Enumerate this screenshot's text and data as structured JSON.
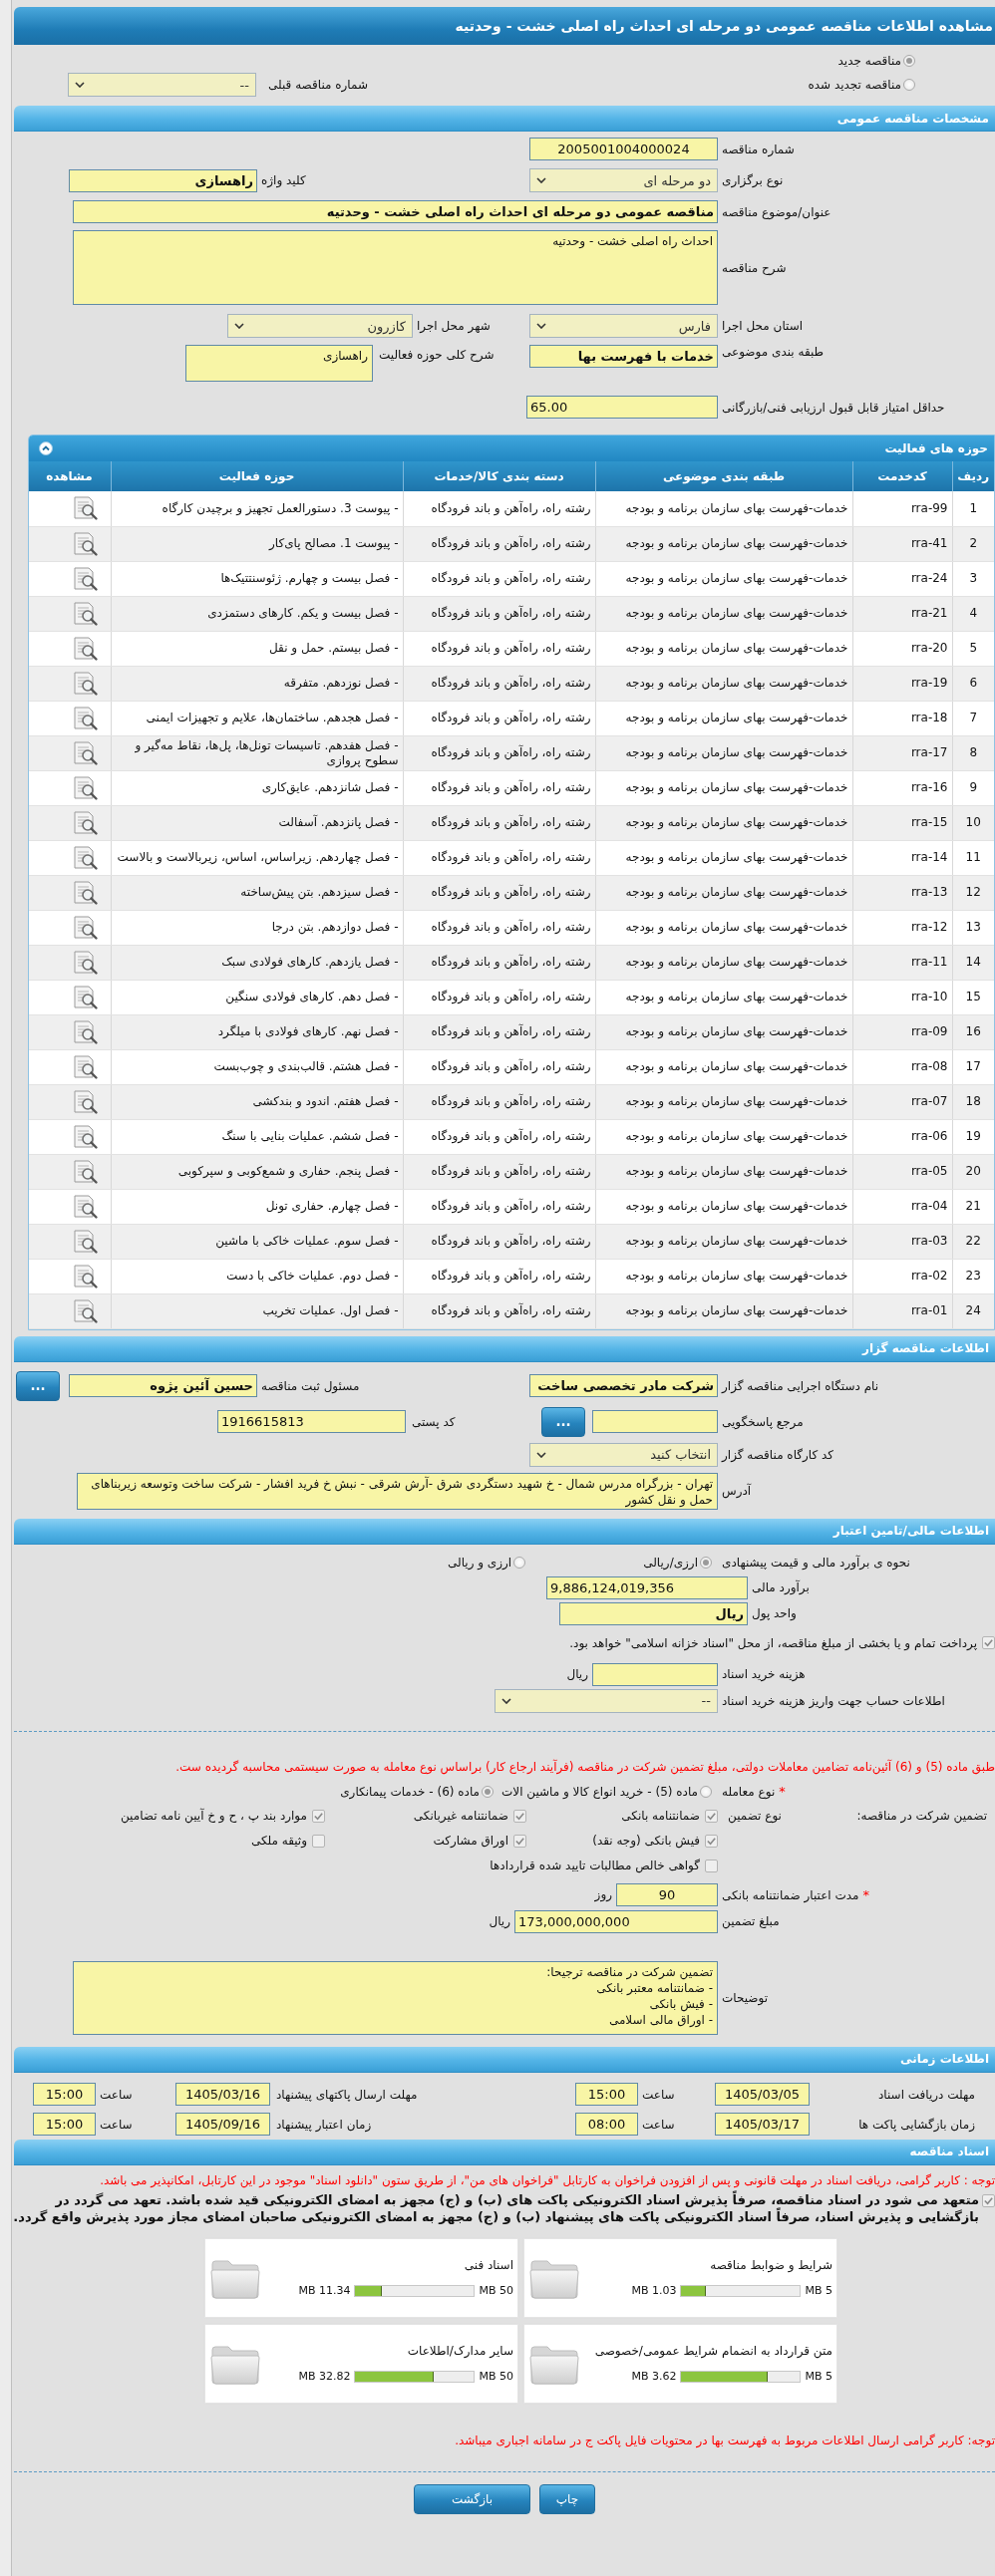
{
  "page_title": "مشاهده اطلاعات مناقصه عمومی دو مرحله ای احداث راه اصلی خشت - وحدتیه",
  "tender_status": [
    {
      "label": "مناقصه جدید",
      "selected": true
    },
    {
      "label": "مناقصه تجدید شده",
      "selected": false
    }
  ],
  "previous_tender": {
    "label": "شماره مناقصه قبلی",
    "value": "--"
  },
  "general": {
    "heading": "مشخصات مناقصه عمومی",
    "number": {
      "label": "شماره مناقصه",
      "value": "2005001004000024"
    },
    "procedure": {
      "label": "نوع برگزاری",
      "value": "دو مرحله ای"
    },
    "keyword": {
      "label": "کلید واژه",
      "value": "راهسازی"
    },
    "subject": {
      "label": "عنوان/موضوع مناقصه",
      "value": "مناقصه عمومی دو مرحله ای احداث راه اصلی خشت - وحدتیه"
    },
    "description": {
      "label": "شرح مناقصه",
      "value": "احداث راه اصلی خشت - وحدتیه"
    },
    "province": {
      "label": "استان محل اجرا",
      "value": "فارس"
    },
    "city": {
      "label": "شهر محل اجرا",
      "value": "کازرون"
    },
    "classification": {
      "label": "طبقه بندی موضوعی",
      "value": "خدمات با فهرست بها"
    },
    "activity_summary": {
      "label": "شرح کلی حوزه فعالیت",
      "value": "راهسازی"
    },
    "min_score": {
      "label": "حداقل امتیاز قابل قبول ارزیابی فنی/بازرگانی",
      "value": "65.00"
    }
  },
  "activities": {
    "heading": "حوزه های فعالیت",
    "columns": [
      "ردیف",
      "کدخدمت",
      "طبقه بندی موضوعی",
      "دسته بندی کالا/خدمات",
      "حوزه فعالیت",
      "مشاهده"
    ],
    "rows": [
      {
        "row": "1",
        "code": "rra-99",
        "classification": "خدمات-فهرست بهای سازمان برنامه و بودجه",
        "group": "رشته راه، راه‌آهن و باند فرودگاه",
        "activity": "- پیوست 3. دستورالعمل تجهیز و برچیدن کارگاه"
      },
      {
        "row": "2",
        "code": "rra-41",
        "classification": "خدمات-فهرست بهای سازمان برنامه و بودجه",
        "group": "رشته راه، راه‌آهن و باند فرودگاه",
        "activity": "- پیوست 1. مصالح پای‌کار"
      },
      {
        "row": "3",
        "code": "rra-24",
        "classification": "خدمات-فهرست بهای سازمان برنامه و بودجه",
        "group": "رشته راه، راه‌آهن و باند فرودگاه",
        "activity": "- فصل بیست و چهارم. ژئوسنتتیک‌ها"
      },
      {
        "row": "4",
        "code": "rra-21",
        "classification": "خدمات-فهرست بهای سازمان برنامه و بودجه",
        "group": "رشته راه، راه‌آهن و باند فرودگاه",
        "activity": "- فصل بیست و یکم. کارهای دستمزدی"
      },
      {
        "row": "5",
        "code": "rra-20",
        "classification": "خدمات-فهرست بهای سازمان برنامه و بودجه",
        "group": "رشته راه، راه‌آهن و باند فرودگاه",
        "activity": "- فصل بیستم. حمل و نقل"
      },
      {
        "row": "6",
        "code": "rra-19",
        "classification": "خدمات-فهرست بهای سازمان برنامه و بودجه",
        "group": "رشته راه، راه‌آهن و باند فرودگاه",
        "activity": "- فصل نوزدهم. متفرقه"
      },
      {
        "row": "7",
        "code": "rra-18",
        "classification": "خدمات-فهرست بهای سازمان برنامه و بودجه",
        "group": "رشته راه، راه‌آهن و باند فرودگاه",
        "activity": "- فصل هجدهم. ساختمان‌ها، علایم و تجهیزات ایمنی"
      },
      {
        "row": "8",
        "code": "rra-17",
        "classification": "خدمات-فهرست بهای سازمان برنامه و بودجه",
        "group": "رشته راه، راه‌آهن و باند فرودگاه",
        "activity": "- فصل هفدهم. تاسیسات تونل‌ها، پل‌ها، نقاط مه‌گیر و سطوح پروازی"
      },
      {
        "row": "9",
        "code": "rra-16",
        "classification": "خدمات-فهرست بهای سازمان برنامه و بودجه",
        "group": "رشته راه، راه‌آهن و باند فرودگاه",
        "activity": "- فصل شانزدهم. عایق‌کاری"
      },
      {
        "row": "10",
        "code": "rra-15",
        "classification": "خدمات-فهرست بهای سازمان برنامه و بودجه",
        "group": "رشته راه، راه‌آهن و باند فرودگاه",
        "activity": "- فصل پانزدهم. آسفالت"
      },
      {
        "row": "11",
        "code": "rra-14",
        "classification": "خدمات-فهرست بهای سازمان برنامه و بودجه",
        "group": "رشته راه، راه‌آهن و باند فرودگاه",
        "activity": "- فصل چهاردهم. زیراساس، اساس، زیربالاست و بالاست"
      },
      {
        "row": "12",
        "code": "rra-13",
        "classification": "خدمات-فهرست بهای سازمان برنامه و بودجه",
        "group": "رشته راه، راه‌آهن و باند فرودگاه",
        "activity": "- فصل سیزدهم. بتن پیش‌ساخته"
      },
      {
        "row": "13",
        "code": "rra-12",
        "classification": "خدمات-فهرست بهای سازمان برنامه و بودجه",
        "group": "رشته راه، راه‌آهن و باند فرودگاه",
        "activity": "- فصل دوازدهم. بتن درجا"
      },
      {
        "row": "14",
        "code": "rra-11",
        "classification": "خدمات-فهرست بهای سازمان برنامه و بودجه",
        "group": "رشته راه، راه‌آهن و باند فرودگاه",
        "activity": "- فصل یازدهم. کارهای فولادی سبک"
      },
      {
        "row": "15",
        "code": "rra-10",
        "classification": "خدمات-فهرست بهای سازمان برنامه و بودجه",
        "group": "رشته راه، راه‌آهن و باند فرودگاه",
        "activity": "- فصل دهم. کارهای فولادی سنگین"
      },
      {
        "row": "16",
        "code": "rra-09",
        "classification": "خدمات-فهرست بهای سازمان برنامه و بودجه",
        "group": "رشته راه، راه‌آهن و باند فرودگاه",
        "activity": "- فصل نهم. کارهای فولادی با میلگرد"
      },
      {
        "row": "17",
        "code": "rra-08",
        "classification": "خدمات-فهرست بهای سازمان برنامه و بودجه",
        "group": "رشته راه، راه‌آهن و باند فرودگاه",
        "activity": "- فصل هشتم. قالب‌بندی و چوب‌بست"
      },
      {
        "row": "18",
        "code": "rra-07",
        "classification": "خدمات-فهرست بهای سازمان برنامه و بودجه",
        "group": "رشته راه، راه‌آهن و باند فرودگاه",
        "activity": "- فصل هفتم. اندود و بندکشی"
      },
      {
        "row": "19",
        "code": "rra-06",
        "classification": "خدمات-فهرست بهای سازمان برنامه و بودجه",
        "group": "رشته راه، راه‌آهن و باند فرودگاه",
        "activity": "- فصل ششم. عملیات بنایی با سنگ"
      },
      {
        "row": "20",
        "code": "rra-05",
        "classification": "خدمات-فهرست بهای سازمان برنامه و بودجه",
        "group": "رشته راه، راه‌آهن و باند فرودگاه",
        "activity": "- فصل پنجم. حفاری و شمع‌کوبی و سپرکوبی"
      },
      {
        "row": "21",
        "code": "rra-04",
        "classification": "خدمات-فهرست بهای سازمان برنامه و بودجه",
        "group": "رشته راه، راه‌آهن و باند فرودگاه",
        "activity": "- فصل چهارم. حفاری تونل"
      },
      {
        "row": "22",
        "code": "rra-03",
        "classification": "خدمات-فهرست بهای سازمان برنامه و بودجه",
        "group": "رشته راه، راه‌آهن و باند فرودگاه",
        "activity": "- فصل سوم. عملیات خاکی با ماشین"
      },
      {
        "row": "23",
        "code": "rra-02",
        "classification": "خدمات-فهرست بهای سازمان برنامه و بودجه",
        "group": "رشته راه، راه‌آهن و باند فرودگاه",
        "activity": "- فصل دوم. عملیات خاکی با دست"
      },
      {
        "row": "24",
        "code": "rra-01",
        "classification": "خدمات-فهرست بهای سازمان برنامه و بودجه",
        "group": "رشته راه، راه‌آهن و باند فرودگاه",
        "activity": "- فصل اول. عملیات تخریب"
      }
    ]
  },
  "organizer": {
    "heading": "اطلاعات مناقصه گزار",
    "agency": {
      "label": "نام دستگاه اجرایی مناقصه گزار",
      "value": "شرکت مادر تخصصی ساخت"
    },
    "registrar": {
      "label": "مسئول ثبت مناقصه",
      "value": "حسین آئین پژوه",
      "button": "..."
    },
    "respondent": {
      "label": "مرجع پاسخگویی",
      "button": "..."
    },
    "postal_code": {
      "label": "کد پستی",
      "value": "1916615813"
    },
    "workshop": {
      "label": "کد کارگاه مناقصه گزار",
      "value": "انتخاب کنید"
    },
    "address": {
      "label": "آدرس",
      "value": "تهران - بزرگراه مدرس شمال - خ شهید دستگردی شرق -آرش شرقی - نبش خ فرید افشار - شرکت ساخت وتوسعه زیربناهای حمل و نقل کشور"
    }
  },
  "finance": {
    "heading": "اطلاعات مالی/تامین اعتبار",
    "estimate_method": {
      "label": "نحوه ی برآورد مالی و قیمت پیشنهادی",
      "options": [
        {
          "label": "ارزی/ریالی",
          "selected": true
        },
        {
          "label": "ارزی و ریالی",
          "selected": false
        }
      ]
    },
    "estimate": {
      "label": "برآورد مالی",
      "value": "9,886,124,019,356"
    },
    "currency": {
      "label": "واحد پول",
      "value": "ریال"
    },
    "islamic_treasury": {
      "label": "پرداخت تمام و یا بخشی از مبلغ مناقصه، از محل \"اسناد خزانه اسلامی\" خواهد بود.",
      "checked": true
    },
    "document_fee": {
      "label": "هزینه خرید اسناد",
      "unit": "ریال"
    },
    "fee_account": {
      "label": "اطلاعات حساب جهت واریز هزینه خرید اسناد",
      "value": "--"
    }
  },
  "guarantee": {
    "notice": "طبق ماده (5) و (6) آئین‌نامه تضامین معاملات دولتی، مبلغ تضمین شرکت در مناقصه (فرآیند ارجاع کار) براساس نوع معامله به صورت سیستمی محاسبه گردیده ست.",
    "deal_type": {
      "label": "نوع معامله",
      "required_mark": "*",
      "options": [
        {
          "label": "ماده (5) - خرید انواع کالا و ماشین الات",
          "selected": false
        },
        {
          "label": "ماده (6) - خدمات پیمانکاری",
          "selected": true
        }
      ]
    },
    "label": "تضمین شرکت در مناقصه:",
    "type_label": "نوع تضمین",
    "types": [
      {
        "label": "ضمانتنامه بانکی",
        "checked": true
      },
      {
        "label": "ضمانتنامه غیربانکی",
        "checked": true
      },
      {
        "label": "موارد بند پ ، ح و خ آیین نامه تضامین",
        "checked": true
      },
      {
        "label": "فیش بانکی (وجه نقد)",
        "checked": true
      },
      {
        "label": "اوراق مشارکت",
        "checked": true
      },
      {
        "label": "وثیقه ملکی",
        "checked": false
      },
      {
        "label": "گواهی خالص مطالبات تایید شده قراردادها",
        "checked": false
      }
    ],
    "validity": {
      "label": "مدت اعتبار ضمانتنامه بانکی",
      "required_mark": "*",
      "value": "90",
      "unit": "روز"
    },
    "amount": {
      "label": "مبلغ تضمین",
      "value": "173,000,000,000",
      "unit": "ریال"
    },
    "notes": {
      "label": "توضیحات",
      "lines": [
        "تضمین شرکت در مناقصه ترجیحا:",
        "- ضمانتنامه معتبر بانکی",
        "- فیش بانکی",
        "- اوراق مالی اسلامی"
      ]
    }
  },
  "schedule": {
    "heading": "اطلاعات زمانی",
    "items": [
      {
        "label": "مهلت دریافت اسناد",
        "date": "1405/03/05",
        "time_label": "ساعت",
        "time": "15:00"
      },
      {
        "label": "مهلت ارسال پاکتهای پیشنهاد",
        "date": "1405/03/16",
        "time_label": "ساعت",
        "time": "15:00"
      },
      {
        "label": "زمان بازگشایی پاکت ها",
        "date": "1405/03/17",
        "time_label": "ساعت",
        "time": "08:00"
      },
      {
        "label": "زمان اعتبار پیشنهاد",
        "date": "1405/09/16",
        "time_label": "ساعت",
        "time": "15:00"
      }
    ]
  },
  "documents": {
    "heading": "اسناد مناقصه",
    "notice": "توجه : کاربر گرامی، دریافت اسناد در مهلت قانونی و پس از افزودن فراخوان به کارتابل \"فراخوان های من\"، از طریق ستون \"دانلود اسناد\" موجود در این کارتابل، امکانپذیر می باشد.",
    "commitment": {
      "text": "متعهد می شود در اسناد مناقصه، صرفاً پذیرش اسناد الکترونیکی پاکت های (ب) و (ج) مجهز به امضای الکترونیکی قید شده باشد. تعهد می گردد در بازگشایی و پذیرش اسناد، صرفاً اسناد الکترونیکی پاکت های پیشنهاد (ب) و (ج) مجهز به امضای الکترونیکی صاحبان امضای مجاز مورد پذیرش واقع گردد.",
      "checked": true
    },
    "files": [
      {
        "name": "شرایط و ضوابط مناقصه",
        "size": "1.03 MB",
        "max": "5 MB",
        "level": 0.206
      },
      {
        "name": "اسناد فنی",
        "size": "11.34 MB",
        "max": "50 MB",
        "level": 0.227
      },
      {
        "name": "متن قرارداد به انضمام شرایط عمومی/خصوصی",
        "size": "3.62 MB",
        "max": "5 MB",
        "level": 0.724
      },
      {
        "name": "سایر مدارک/اطلاعات",
        "size": "32.82 MB",
        "max": "50 MB",
        "level": 0.656
      }
    ],
    "footer_notice": "توجه: کاربر گرامی ارسال اطلاعات مربوط به فهرست بها در محتویات فایل پاکت ج در سامانه اجباری میباشد."
  },
  "buttons": [
    {
      "label": "چاپ"
    },
    {
      "label": "بازگشت"
    }
  ]
}
